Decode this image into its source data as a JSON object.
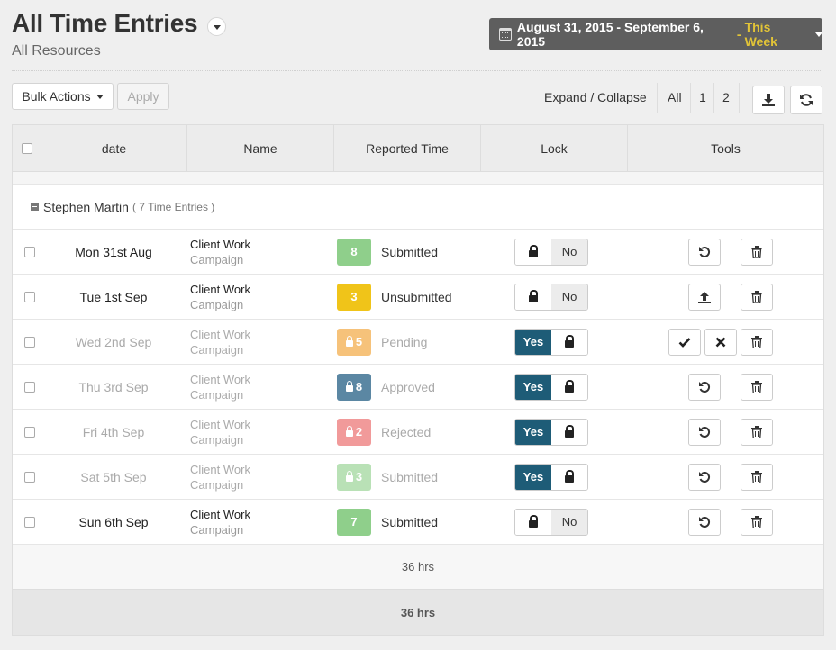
{
  "header": {
    "title": "All Time Entries",
    "subtitle": "All Resources",
    "date_range": "August 31, 2015 - September 6, 2015",
    "date_separator": "-",
    "period_label": "This Week"
  },
  "toolbar": {
    "bulk_label": "Bulk Actions",
    "apply_label": "Apply",
    "expand_collapse": "Expand / Collapse",
    "page_all": "All",
    "page_1": "1",
    "page_2": "2"
  },
  "table": {
    "columns": [
      "date",
      "Name",
      "Reported Time",
      "Lock",
      "Tools"
    ],
    "group": {
      "name": "Stephen Martin",
      "count": "( 7 Time Entries )"
    },
    "rows": [
      {
        "date": "Mon 31st Aug",
        "name": "Client Work",
        "project": "Campaign",
        "hours": "8",
        "status": "Submitted",
        "lock_label": "No"
      },
      {
        "date": "Tue 1st Sep",
        "name": "Client Work",
        "project": "Campaign",
        "hours": "3",
        "status": "Unsubmitted",
        "lock_label": "No"
      },
      {
        "date": "Wed 2nd Sep",
        "name": "Client Work",
        "project": "Campaign",
        "hours": "5",
        "status": "Pending",
        "lock_label": "Yes"
      },
      {
        "date": "Thu 3rd Sep",
        "name": "Client Work",
        "project": "Campaign",
        "hours": "8",
        "status": "Approved",
        "lock_label": "Yes"
      },
      {
        "date": "Fri 4th Sep",
        "name": "Client Work",
        "project": "Campaign",
        "hours": "2",
        "status": "Rejected",
        "lock_label": "Yes"
      },
      {
        "date": "Sat 5th Sep",
        "name": "Client Work",
        "project": "Campaign",
        "hours": "3",
        "status": "Submitted",
        "lock_label": "Yes"
      },
      {
        "date": "Sun 6th Sep",
        "name": "Client Work",
        "project": "Campaign",
        "hours": "7",
        "status": "Submitted",
        "lock_label": "No"
      }
    ],
    "group_total": "36 hrs",
    "grand_total": "36 hrs"
  },
  "colors": {
    "submitted": "#8fcf8b",
    "unsubmitted": "#f0c419",
    "pending": "#f6c27a",
    "approved": "#5b87a3",
    "rejected": "#f19a9a",
    "submitted_locked": "#b9e1b6",
    "locked_yes": "#1e5c77",
    "this_week": "#e2c437"
  },
  "icons": [
    "chevron-down-icon",
    "calendar-icon",
    "download-icon",
    "refresh-icon",
    "lock-icon",
    "undo-icon",
    "trash-icon",
    "upload-icon",
    "check-icon",
    "close-icon",
    "minus-icon"
  ]
}
